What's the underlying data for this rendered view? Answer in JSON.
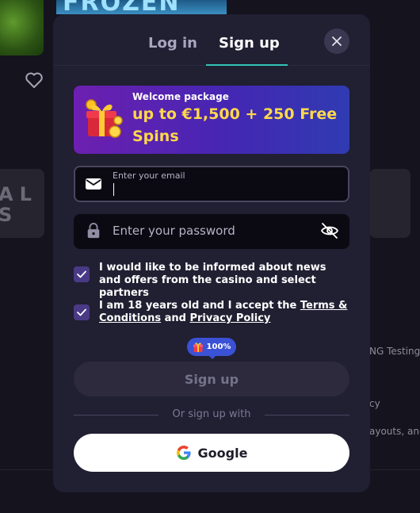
{
  "background": {
    "frozen_text": "FROZEN",
    "left_tile_text": [
      "AL",
      "S"
    ],
    "footer_fragments": [
      "NG Testing",
      "cy",
      "ayouts, and"
    ]
  },
  "modal": {
    "tabs": {
      "login": "Log in",
      "signup": "Sign up",
      "active": "signup"
    },
    "promo": {
      "subtitle": "Welcome package",
      "title": "up to €1,500 + 250 Free Spins"
    },
    "email": {
      "label": "Enter your email",
      "value": ""
    },
    "password": {
      "placeholder": "Enter your password"
    },
    "consent_news": {
      "text": "I would like to be informed about news and offers from the casino and select partners",
      "checked": true
    },
    "consent_age": {
      "prefix": "I am 18 years old and I accept the ",
      "terms_link": "Terms & Conditions",
      "middle": " and ",
      "privacy_link": "Privacy Policy",
      "checked": true
    },
    "badge": "100%",
    "signup_button": "Sign up",
    "divider_text": "Or sign up with",
    "google_button": "Google"
  },
  "colors": {
    "accent_tab": "#32c4b8",
    "promo_title": "#ffd84a",
    "badge": "#3b52d6",
    "checkbox": "#4a3a86"
  }
}
